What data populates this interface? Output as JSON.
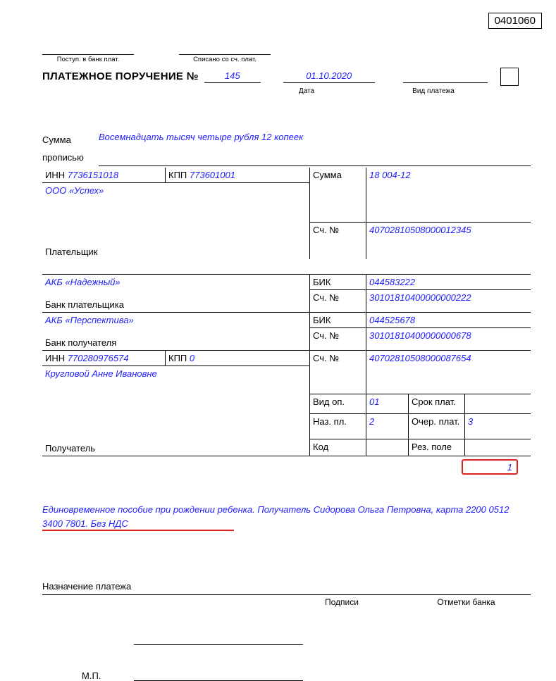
{
  "form_code": "0401060",
  "top": {
    "recv_bank": "Поступ. в банк плат.",
    "debited": "Списано со сч. плат."
  },
  "title": {
    "label": "ПЛАТЕЖНОЕ ПОРУЧЕНИЕ №",
    "number": "145",
    "date": "01.10.2020",
    "date_cap": "Дата",
    "vid_cap": "Вид платежа"
  },
  "sum_words": {
    "l1": "Сумма",
    "l2": "прописью",
    "text": "Восемнадцать тысяч четыре рубля 12 копеек"
  },
  "payer": {
    "inn_lbl": "ИНН",
    "inn": "7736151018",
    "kpp_lbl": "КПП",
    "kpp": "773601001",
    "sum_lbl": "Сумма",
    "sum": "18 004-12",
    "name": "ООО «Успех»",
    "acc_lbl": "Сч. №",
    "acc": "40702810508000012345",
    "payer_lbl": "Плательщик"
  },
  "payer_bank": {
    "name": "АКБ «Надежный»",
    "bik_lbl": "БИК",
    "bik": "044583222",
    "acc_lbl": "Сч. №",
    "acc": "30101810400000000222",
    "lbl": "Банк плательщика"
  },
  "recv_bank": {
    "name": "АКБ «Перспектива»",
    "bik_lbl": "БИК",
    "bik": "044525678",
    "acc_lbl": "Сч. №",
    "acc": "30101810400000000678",
    "lbl": "Банк получателя"
  },
  "receiver": {
    "inn_lbl": "ИНН",
    "inn": "770280976574",
    "kpp_lbl": "КПП",
    "kpp": "0",
    "acc_lbl": "Сч. №",
    "acc": "40702810508000087654",
    "name": "Кругловой Анне Ивановне",
    "lbl": "Получатель"
  },
  "ops": {
    "vid_op_lbl": "Вид оп.",
    "vid_op": "01",
    "srok_lbl": "Срок плат.",
    "naz_lbl": "Наз. пл.",
    "naz": "2",
    "ocher_lbl": "Очер. плат.",
    "ocher": "3",
    "kod_lbl": "Код",
    "rez_lbl": "Рез. поле"
  },
  "red_val": "1",
  "note": "Единовременное пособие при рождении ребенка. Получатель Сидорова Ольга Петровна, карта 2200 0512 3400 7801. Без НДС",
  "footer": {
    "purpose": "Назначение платежа",
    "sign": "Подписи",
    "bank_marks": "Отметки банка",
    "mp": "М.П."
  }
}
